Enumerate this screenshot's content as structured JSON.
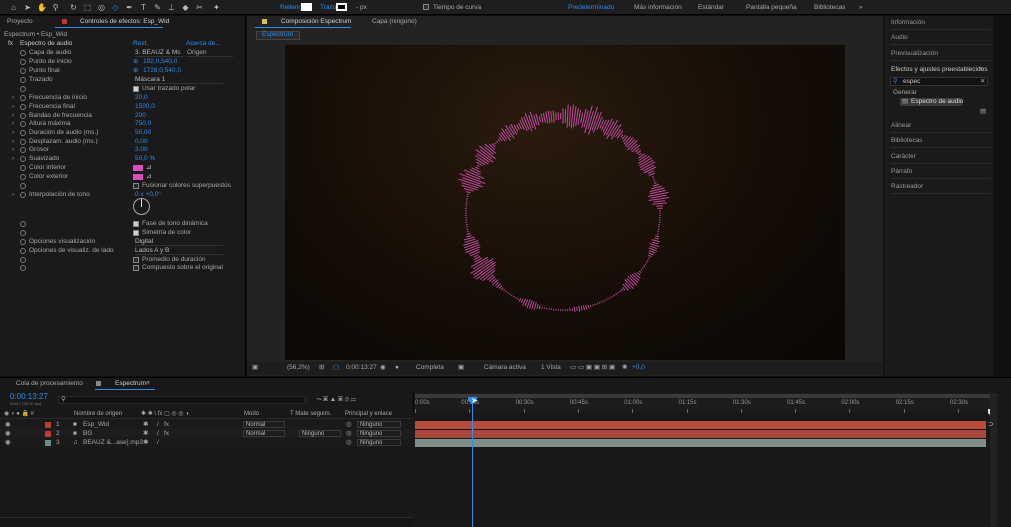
{
  "toolbar": {
    "relleno_label": "Relleno",
    "trazo_label": "Trazo",
    "px_label": "- px",
    "tiempo_curva_label": "Tiempo de curva",
    "workspaces": [
      "Predeterminado",
      "Más información",
      "Estándar",
      "Pantalla pequeña",
      "Bibliotecas"
    ]
  },
  "effects_panel": {
    "tab_proyecto": "Proyecto",
    "tab_controles": "Controles de efectos: Esp_Wid",
    "breadcrumb": "Espectrum • Esp_Wid",
    "effect_name": "Espectro de audio",
    "reset": "Rest.",
    "about": "Acerca de...",
    "properties": [
      {
        "label": "Capa de audio",
        "value": "3. BEAUZ & Mc"
      },
      {
        "label": "Punto de inicio",
        "value": "192,0,540,0"
      },
      {
        "label": "Punto final",
        "value": "1728,0,540,0"
      },
      {
        "label": "Trazado",
        "value": "Máscara 1"
      },
      {
        "label": "",
        "value": "Usar trazado polar"
      },
      {
        "label": "Frecuencia de inicio",
        "value": "20,0"
      },
      {
        "label": "Frecuencia final",
        "value": "1500,0"
      },
      {
        "label": "Bandas de frecuencia",
        "value": "200"
      },
      {
        "label": "Altura máxima",
        "value": "750,0"
      },
      {
        "label": "Duración de audio (ms.)",
        "value": "50,00"
      },
      {
        "label": "Desplazam. audio (ms.)",
        "value": "0,00"
      },
      {
        "label": "Grosor",
        "value": "3,00"
      },
      {
        "label": "Suavizado",
        "value": "50,0 %"
      },
      {
        "label": "Color interior",
        "value": ""
      },
      {
        "label": "Color exterior",
        "value": ""
      },
      {
        "label": "",
        "value": "Fusionar colores superpuestos"
      },
      {
        "label": "Interpolación de tono",
        "value": "0 x +0,0°"
      },
      {
        "label": "",
        "value": "Fase de tono dinámica"
      },
      {
        "label": "",
        "value": "Simetría de color"
      },
      {
        "label": "Opciones visualización",
        "value": "Digital"
      },
      {
        "label": "Opciones de visualiz. de lado",
        "value": "Lados A y B"
      },
      {
        "label": "",
        "value": "Promedio de duración"
      },
      {
        "label": "",
        "value": "Compuesto sobre el original"
      }
    ],
    "origin_label": "Origen",
    "color_swatch": "#d94fc2"
  },
  "composition": {
    "tab_label": "Composición Espectrum",
    "layer_tab": "Capa (ninguno)",
    "sub_tab": "Espectrum",
    "zoom": "(56,2%)",
    "timecode": "0:00:13:27",
    "resolution": "Completa",
    "camera": "Cámara activa",
    "views": "1 Vista",
    "exposure": "+0,0",
    "accent": "#c04aa0"
  },
  "right_panel": {
    "items_top": [
      "Información",
      "Audio",
      "Previsualización"
    ],
    "effects_header": "Efectos y ajustes preestablecidos",
    "search_value": "espec",
    "category": "Generar",
    "result": "Espectro de audio",
    "items_bottom": [
      "Alinear",
      "Bibliotecas",
      "Carácter",
      "Párrafo",
      "Rastreador"
    ]
  },
  "timeline": {
    "tab_cola": "Cola de procesamiento",
    "tab_comp": "Espectrum",
    "timecode": "0:00:13:27",
    "sub_timecode": "00417 (30.00 fps)",
    "headers": {
      "name": "Nombre de origen",
      "mode": "Modo",
      "trkmat": "T  Mate seguim.",
      "parent": "Principal y enlace"
    },
    "ruler": [
      "0:00s",
      "00:15s",
      "00:30s",
      "00:45s",
      "01:00s",
      "01:15s",
      "01:30s",
      "01:45s",
      "02:00s",
      "02:15s",
      "02:30s"
    ],
    "layers": [
      {
        "num": "1",
        "name": "Esp_Wid",
        "mode": "Normal",
        "trkmat": "",
        "parent": "Ninguno",
        "color": "#c0392b"
      },
      {
        "num": "2",
        "name": "BG",
        "mode": "Normal",
        "trkmat": "Ninguno",
        "parent": "Ninguno",
        "color": "#c0392b"
      },
      {
        "num": "3",
        "name": "BEAUZ &...ase].mp3",
        "mode": "",
        "trkmat": "",
        "parent": "Ninguno",
        "color": "#6a8f8c"
      }
    ],
    "bar_colors": [
      "#b84a3e",
      "#a8483d",
      "#7d8e8b"
    ]
  }
}
